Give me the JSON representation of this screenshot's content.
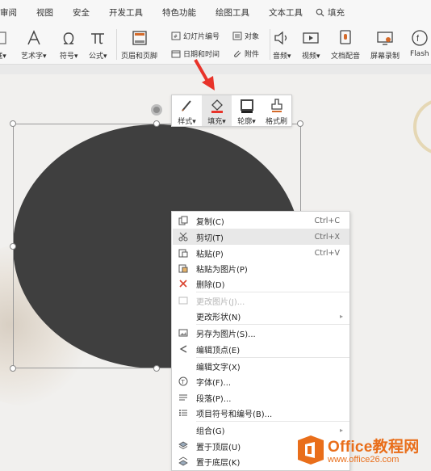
{
  "ribbon": {
    "tabs": [
      "审阅",
      "视图",
      "安全",
      "开发工具",
      "特色功能",
      "绘图工具",
      "文本工具"
    ],
    "search_label": "填充"
  },
  "toolbar": {
    "frame_label": "框",
    "art_text": "艺术字",
    "symbol": "符号",
    "formula": "公式",
    "header_footer": "页眉和页脚",
    "slide_number": "幻灯片编号",
    "object": "对象",
    "datetime": "日期和时间",
    "attachment": "附件",
    "audio": "音频",
    "video": "视频",
    "doc_assistant": "文档配音",
    "screen_record": "屏幕录制",
    "flash": "Flash"
  },
  "mini_toolbar": {
    "style": "样式",
    "fill": "填充",
    "outline": "轮廓",
    "format_painter": "格式刷"
  },
  "context_menu": {
    "copy": "复制(C)",
    "copy_sc": "Ctrl+C",
    "cut": "剪切(T)",
    "cut_sc": "Ctrl+X",
    "paste": "粘贴(P)",
    "paste_sc": "Ctrl+V",
    "paste_as_picture": "粘贴为图片(P)",
    "delete": "删除(D)",
    "change_picture": "更改图片(J)...",
    "change_shape": "更改形状(N)",
    "save_as_picture": "另存为图片(S)...",
    "edit_points": "编辑顶点(E)",
    "edit_text": "编辑文字(X)",
    "font": "字体(F)...",
    "paragraph": "段落(P)...",
    "bullets": "项目符号和编号(B)...",
    "group": "组合(G)",
    "bring_to_front": "置于顶层(U)",
    "send_to_back": "置于底层(K)"
  },
  "watermark": {
    "title_en": "Office",
    "title_cn": "教程网",
    "url": "www.office26.com"
  },
  "colors": {
    "shape_fill": "#3f3f3f",
    "accent_arrow": "#e8332a",
    "watermark": "#e96e1a"
  }
}
